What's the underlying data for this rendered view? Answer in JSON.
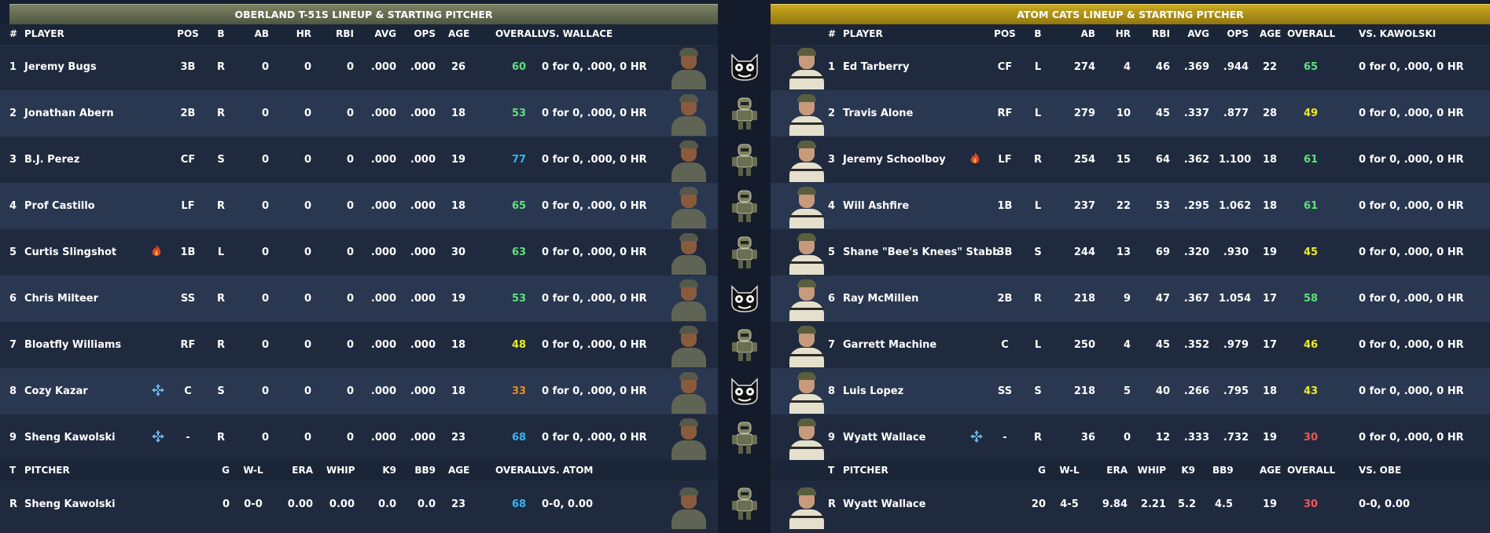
{
  "colors": {
    "green": "#5ee07a",
    "cyan": "#35b6f0",
    "yellow": "#ecec28",
    "orange": "#f08a1e",
    "red": "#f25656"
  },
  "left": {
    "title": "OBERLAND T-51S LINEUP & STARTING PITCHER",
    "headers": {
      "num": "#",
      "player": "PLAYER",
      "pos": "POS",
      "b": "B",
      "ab": "AB",
      "hr": "HR",
      "rbi": "RBI",
      "avg": "AVG",
      "ops": "OPS",
      "age": "AGE",
      "overall": "OVERALL",
      "vs": "VS. WALLACE"
    },
    "rows": [
      {
        "num": "1",
        "name": "Jeremy Bugs",
        "icon": "",
        "pos": "3B",
        "b": "R",
        "ab": "0",
        "hr": "0",
        "rbi": "0",
        "avg": ".000",
        "ops": ".000",
        "age": "26",
        "ovr": "60",
        "ovrColor": "#5ee07a",
        "vs": "0 for 0, .000, 0 HR"
      },
      {
        "num": "2",
        "name": "Jonathan Abern",
        "icon": "",
        "pos": "2B",
        "b": "R",
        "ab": "0",
        "hr": "0",
        "rbi": "0",
        "avg": ".000",
        "ops": ".000",
        "age": "18",
        "ovr": "53",
        "ovrColor": "#5ee07a",
        "vs": "0 for 0, .000, 0 HR"
      },
      {
        "num": "3",
        "name": "B.J. Perez",
        "icon": "",
        "pos": "CF",
        "b": "S",
        "ab": "0",
        "hr": "0",
        "rbi": "0",
        "avg": ".000",
        "ops": ".000",
        "age": "19",
        "ovr": "77",
        "ovrColor": "#35b6f0",
        "vs": "0 for 0, .000, 0 HR"
      },
      {
        "num": "4",
        "name": "Prof Castillo",
        "icon": "",
        "pos": "LF",
        "b": "R",
        "ab": "0",
        "hr": "0",
        "rbi": "0",
        "avg": ".000",
        "ops": ".000",
        "age": "18",
        "ovr": "65",
        "ovrColor": "#5ee07a",
        "vs": "0 for 0, .000, 0 HR"
      },
      {
        "num": "5",
        "name": "Curtis Slingshot",
        "icon": "flame",
        "pos": "1B",
        "b": "L",
        "ab": "0",
        "hr": "0",
        "rbi": "0",
        "avg": ".000",
        "ops": ".000",
        "age": "30",
        "ovr": "63",
        "ovrColor": "#5ee07a",
        "vs": "0 for 0, .000, 0 HR"
      },
      {
        "num": "6",
        "name": "Chris Milteer",
        "icon": "",
        "pos": "SS",
        "b": "R",
        "ab": "0",
        "hr": "0",
        "rbi": "0",
        "avg": ".000",
        "ops": ".000",
        "age": "19",
        "ovr": "53",
        "ovrColor": "#5ee07a",
        "vs": "0 for 0, .000, 0 HR"
      },
      {
        "num": "7",
        "name": "Bloatfly Williams",
        "icon": "",
        "pos": "RF",
        "b": "R",
        "ab": "0",
        "hr": "0",
        "rbi": "0",
        "avg": ".000",
        "ops": ".000",
        "age": "18",
        "ovr": "48",
        "ovrColor": "#ecec28",
        "vs": "0 for 0, .000, 0 HR"
      },
      {
        "num": "8",
        "name": "Cozy Kazar",
        "icon": "move",
        "pos": "C",
        "b": "S",
        "ab": "0",
        "hr": "0",
        "rbi": "0",
        "avg": ".000",
        "ops": ".000",
        "age": "18",
        "ovr": "33",
        "ovrColor": "#f08a1e",
        "vs": "0 for 0, .000, 0 HR"
      },
      {
        "num": "9",
        "name": "Sheng Kawolski",
        "icon": "move",
        "pos": "-",
        "b": "R",
        "ab": "0",
        "hr": "0",
        "rbi": "0",
        "avg": ".000",
        "ops": ".000",
        "age": "23",
        "ovr": "68",
        "ovrColor": "#35b6f0",
        "vs": "0 for 0, .000, 0 HR"
      }
    ],
    "pitcher_headers": {
      "t": "T",
      "pitcher": "PITCHER",
      "g": "G",
      "wl": "W-L",
      "era": "ERA",
      "whip": "WHIP",
      "k9": "K9",
      "bb9": "BB9",
      "age": "AGE",
      "overall": "OVERALL",
      "vs": "VS. ATOM"
    },
    "pitcher": {
      "t": "R",
      "name": "Sheng Kawolski",
      "g": "0",
      "wl": "0-0",
      "era": "0.00",
      "whip": "0.00",
      "k9": "0.0",
      "bb9": "0.0",
      "age": "23",
      "ovr": "68",
      "ovrColor": "#35b6f0",
      "vs": "0-0, 0.00"
    }
  },
  "right": {
    "title": "ATOM CATS LINEUP & STARTING PITCHER",
    "headers": {
      "num": "#",
      "player": "PLAYER",
      "pos": "POS",
      "b": "B",
      "ab": "AB",
      "hr": "HR",
      "rbi": "RBI",
      "avg": "AVG",
      "ops": "OPS",
      "age": "AGE",
      "overall": "OVERALL",
      "vs": "VS. KAWOLSKI"
    },
    "rows": [
      {
        "num": "1",
        "name": "Ed Tarberry",
        "icon": "",
        "pos": "CF",
        "b": "L",
        "ab": "274",
        "hr": "4",
        "rbi": "46",
        "avg": ".369",
        "ops": ".944",
        "age": "22",
        "ovr": "65",
        "ovrColor": "#5ee07a",
        "vs": "0 for 0, .000, 0 HR"
      },
      {
        "num": "2",
        "name": "Travis Alone",
        "icon": "",
        "pos": "RF",
        "b": "L",
        "ab": "279",
        "hr": "10",
        "rbi": "45",
        "avg": ".337",
        "ops": ".877",
        "age": "28",
        "ovr": "49",
        "ovrColor": "#ecec28",
        "vs": "0 for 0, .000, 0 HR"
      },
      {
        "num": "3",
        "name": "Jeremy Schoolboy",
        "icon": "flame",
        "pos": "LF",
        "b": "R",
        "ab": "254",
        "hr": "15",
        "rbi": "64",
        "avg": ".362",
        "ops": "1.100",
        "age": "18",
        "ovr": "61",
        "ovrColor": "#5ee07a",
        "vs": "0 for 0, .000, 0 HR"
      },
      {
        "num": "4",
        "name": "Will Ashfire",
        "icon": "",
        "pos": "1B",
        "b": "L",
        "ab": "237",
        "hr": "22",
        "rbi": "53",
        "avg": ".295",
        "ops": "1.062",
        "age": "18",
        "ovr": "61",
        "ovrColor": "#5ee07a",
        "vs": "0 for 0, .000, 0 HR"
      },
      {
        "num": "5",
        "name": "Shane \"Bee's Knees\" Stabb",
        "icon": "",
        "pos": "3B",
        "b": "S",
        "ab": "244",
        "hr": "13",
        "rbi": "69",
        "avg": ".320",
        "ops": ".930",
        "age": "19",
        "ovr": "45",
        "ovrColor": "#ecec28",
        "vs": "0 for 0, .000, 0 HR"
      },
      {
        "num": "6",
        "name": "Ray McMillen",
        "icon": "",
        "pos": "2B",
        "b": "R",
        "ab": "218",
        "hr": "9",
        "rbi": "47",
        "avg": ".367",
        "ops": "1.054",
        "age": "17",
        "ovr": "58",
        "ovrColor": "#5ee07a",
        "vs": "0 for 0, .000, 0 HR"
      },
      {
        "num": "7",
        "name": "Garrett Machine",
        "icon": "",
        "pos": "C",
        "b": "L",
        "ab": "250",
        "hr": "4",
        "rbi": "45",
        "avg": ".352",
        "ops": ".979",
        "age": "17",
        "ovr": "46",
        "ovrColor": "#ecec28",
        "vs": "0 for 0, .000, 0 HR"
      },
      {
        "num": "8",
        "name": "Luis Lopez",
        "icon": "",
        "pos": "SS",
        "b": "S",
        "ab": "218",
        "hr": "5",
        "rbi": "40",
        "avg": ".266",
        "ops": ".795",
        "age": "18",
        "ovr": "43",
        "ovrColor": "#ecec28",
        "vs": "0 for 0, .000, 0 HR"
      },
      {
        "num": "9",
        "name": "Wyatt Wallace",
        "icon": "move",
        "pos": "-",
        "b": "R",
        "ab": "36",
        "hr": "0",
        "rbi": "12",
        "avg": ".333",
        "ops": ".732",
        "age": "19",
        "ovr": "30",
        "ovrColor": "#f25656",
        "vs": "0 for 0, .000, 0 HR"
      }
    ],
    "pitcher_headers": {
      "t": "T",
      "pitcher": "PITCHER",
      "g": "G",
      "wl": "W-L",
      "era": "ERA",
      "whip": "WHIP",
      "k9": "K9",
      "bb9": "BB9",
      "age": "AGE",
      "overall": "OVERALL",
      "vs": "VS. OBE"
    },
    "pitcher": {
      "t": "R",
      "name": "Wyatt Wallace",
      "g": "20",
      "wl": "4-5",
      "era": "9.84",
      "whip": "2.21",
      "k9": "5.2",
      "bb9": "4.5",
      "age": "19",
      "ovr": "30",
      "ovrColor": "#f25656",
      "vs": "0-0, 0.00"
    }
  },
  "matchup_logos": [
    "cat-mascot-icon",
    "robot-mascot-icon",
    "robot-mascot-icon",
    "robot-mascot-icon",
    "robot-mascot-icon",
    "cat-mascot-icon",
    "robot-mascot-icon",
    "cat-mascot-icon",
    "robot-mascot-icon",
    "robot-mascot-icon"
  ]
}
